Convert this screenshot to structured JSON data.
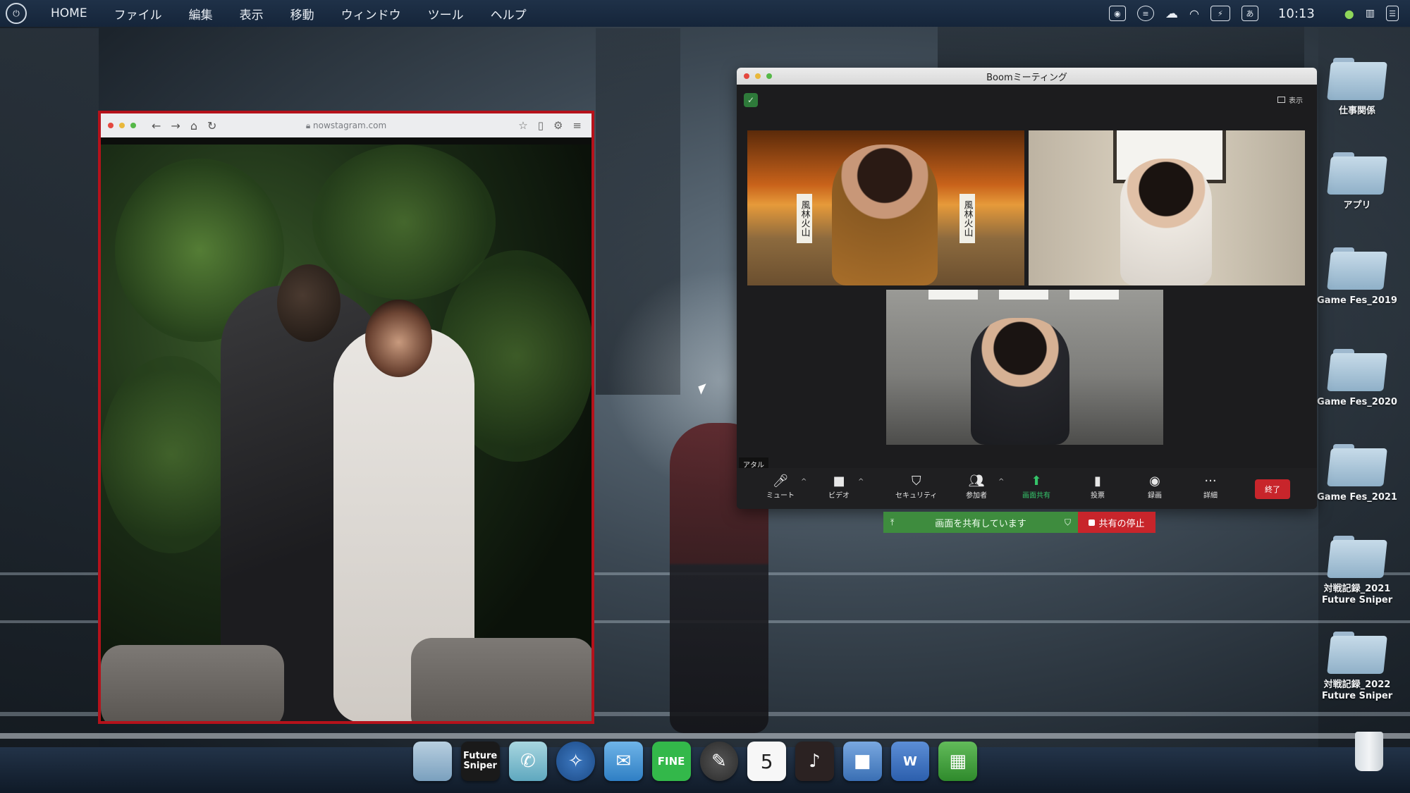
{
  "menubar": {
    "items": [
      "HOME",
      "ファイル",
      "編集",
      "表示",
      "移動",
      "ウィンドウ",
      "ツール",
      "ヘルプ"
    ],
    "ime_label": "あ",
    "clock": "10:13"
  },
  "browser": {
    "url": "nowstagram.com"
  },
  "meeting": {
    "title": "Boomミーティング",
    "view_label": "表示",
    "participant_name": "アタル",
    "tile1_banner_left": "風林火山",
    "tile1_banner_right": "風林火山",
    "controls": {
      "mute": "ミュート",
      "video": "ビデオ",
      "security": "セキュリティ",
      "participants": "参加者",
      "share": "画面共有",
      "poll": "投票",
      "record": "録画",
      "more": "詳細",
      "end": "終了"
    },
    "sharing_banner": "画面を共有しています",
    "stop_share": "共有の停止"
  },
  "desktop": {
    "folders": [
      "仕事関係",
      "アプリ",
      "Game Fes_2019",
      "Game Fes_2020",
      "Game Fes_2021",
      "対戦記録_2021\nFuture Sniper",
      "対戦記録_2022\nFuture Sniper"
    ]
  },
  "dock": {
    "future_sniper_label": "Future\nSniper",
    "fine_label": "FINE",
    "calendar_day": "5",
    "word_letter": "W"
  }
}
